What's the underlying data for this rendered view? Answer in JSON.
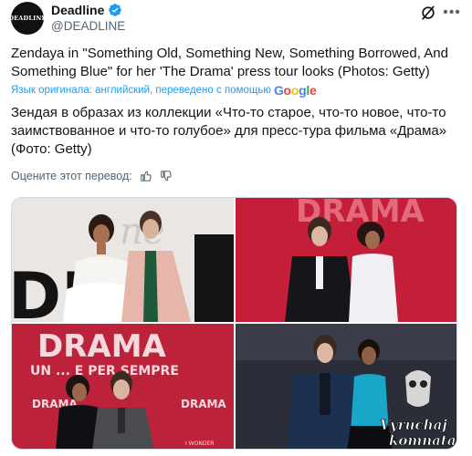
{
  "account": {
    "display_name": "Deadline",
    "handle": "@DEADLINE",
    "avatar_text": "DEADLINE"
  },
  "post": {
    "text": "Zendaya in \"Something Old, Something New, Something Borrowed, And Something Blue\" for her 'The Drama' press tour looks (Photos: Getty)",
    "translated_from": "Язык оригинала: английский, переведено с помощью",
    "translation": "Зендая в образах из коллекции «Что-то старое, что-то новое, что-то заимствованное и что-то голубое» для пресс-тура фильма «Драма» (Фото: Getty)",
    "rate_translation": "Оцените этот перевод:"
  },
  "icons": {
    "verified": "verified-badge-icon",
    "grok": "grok-icon",
    "more": "more-icon",
    "thumbs_up": "thumbs-up-icon",
    "thumbs_down": "thumbs-down-icon"
  },
  "photos": {
    "p1_sign": "ne",
    "p1_big": "DR",
    "p2_sign": "DRAMA",
    "p3_sign": "DRAMA",
    "p3_sub": "UN ... E PER SEMPRE",
    "p3_small_1": "DRAMA",
    "p3_small_2": "DRAMA",
    "p3_small_3": "I WONDER",
    "watermark_1": "Vyruchaj",
    "watermark_2": "komnata"
  },
  "colors": {
    "accent": "#1d9bf0",
    "text": "#0f1419",
    "muted": "#536471"
  }
}
